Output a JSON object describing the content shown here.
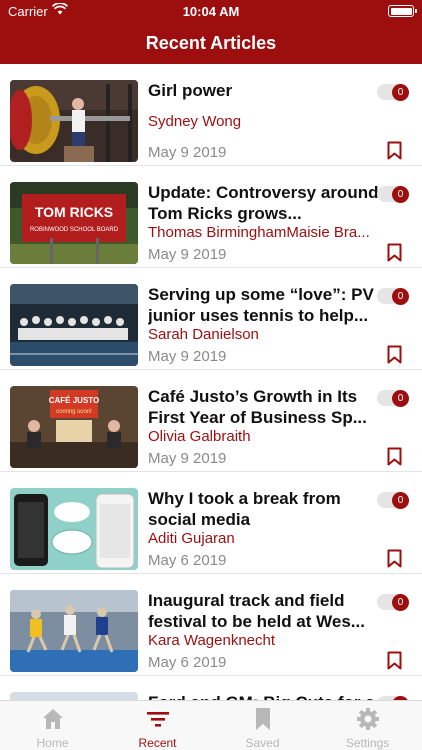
{
  "status_bar": {
    "carrier": "Carrier",
    "time": "10:04 AM"
  },
  "header": {
    "title": "Recent Articles"
  },
  "colors": {
    "brand": "#9d0e0f",
    "author": "#9d0e0f",
    "date": "#8a8a8a",
    "tab_inactive": "#b8b8b8"
  },
  "articles": [
    {
      "title": "Girl power",
      "author": "Sydney Wong",
      "date": "May 9 2019",
      "badge": "0",
      "image": "weightlifting-photo"
    },
    {
      "title": "Update: Controversy around Tom Ricks grows...",
      "author": "Thomas BirminghamMaisie Bra...",
      "date": "May 9 2019",
      "badge": "0",
      "image": "campaign-sign-photo"
    },
    {
      "title": "Serving up some “love”: PV junior uses tennis to help...",
      "author": "Sarah Danielson",
      "date": "May 9 2019",
      "badge": "0",
      "image": "tennis-team-photo"
    },
    {
      "title": "Café Justo’s Growth in Its First Year of Business Sp...",
      "author": "Olivia Galbraith",
      "date": "May 9 2019",
      "badge": "0",
      "image": "cafe-booth-photo"
    },
    {
      "title": "Why I took a break from social media",
      "author": "Aditi Gujaran",
      "date": "May 6 2019",
      "badge": "0",
      "image": "phones-illustration"
    },
    {
      "title": "Inaugural track and field festival to be held at Wes...",
      "author": "Kara Wagenknecht",
      "date": "May 6 2019",
      "badge": "0",
      "image": "track-race-photo"
    },
    {
      "title": "Ford and GM: Big Cuts for a",
      "author": "",
      "date": "",
      "badge": "0",
      "image": "partial-photo"
    }
  ],
  "tabbar": {
    "tabs": [
      {
        "label": "Home",
        "icon": "home-icon",
        "active": false
      },
      {
        "label": "Recent",
        "icon": "recent-icon",
        "active": true
      },
      {
        "label": "Saved",
        "icon": "bookmark-icon",
        "active": false
      },
      {
        "label": "Settings",
        "icon": "gear-icon",
        "active": false
      }
    ]
  }
}
